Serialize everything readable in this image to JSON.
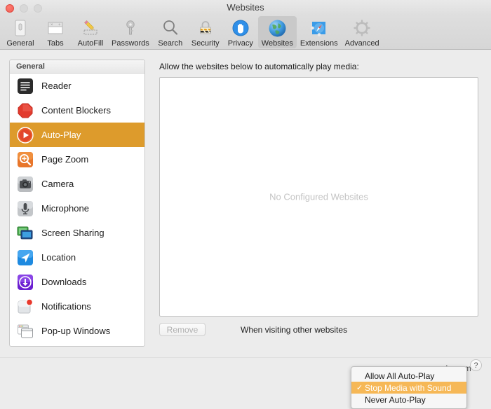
{
  "window": {
    "title": "Websites",
    "traffic_lights": [
      "close",
      "minimize",
      "zoom"
    ]
  },
  "toolbar": {
    "items": [
      {
        "label": "General",
        "icon": "general-icon",
        "selected": false
      },
      {
        "label": "Tabs",
        "icon": "tabs-icon",
        "selected": false
      },
      {
        "label": "AutoFill",
        "icon": "autofill-icon",
        "selected": false
      },
      {
        "label": "Passwords",
        "icon": "passwords-icon",
        "selected": false
      },
      {
        "label": "Search",
        "icon": "search-icon",
        "selected": false
      },
      {
        "label": "Security",
        "icon": "security-icon",
        "selected": false
      },
      {
        "label": "Privacy",
        "icon": "privacy-icon",
        "selected": false
      },
      {
        "label": "Websites",
        "icon": "websites-icon",
        "selected": true
      },
      {
        "label": "Extensions",
        "icon": "extensions-icon",
        "selected": false
      },
      {
        "label": "Advanced",
        "icon": "advanced-icon",
        "selected": false
      }
    ]
  },
  "sidebar": {
    "header": "General",
    "items": [
      {
        "label": "Reader",
        "icon": "reader-icon",
        "selected": false
      },
      {
        "label": "Content Blockers",
        "icon": "content-blockers-icon",
        "selected": false
      },
      {
        "label": "Auto-Play",
        "icon": "auto-play-icon",
        "selected": true
      },
      {
        "label": "Page Zoom",
        "icon": "page-zoom-icon",
        "selected": false
      },
      {
        "label": "Camera",
        "icon": "camera-icon",
        "selected": false
      },
      {
        "label": "Microphone",
        "icon": "microphone-icon",
        "selected": false
      },
      {
        "label": "Screen Sharing",
        "icon": "screen-sharing-icon",
        "selected": false
      },
      {
        "label": "Location",
        "icon": "location-icon",
        "selected": false
      },
      {
        "label": "Downloads",
        "icon": "downloads-icon",
        "selected": false
      },
      {
        "label": "Notifications",
        "icon": "notifications-icon",
        "selected": false
      },
      {
        "label": "Pop-up Windows",
        "icon": "popup-windows-icon",
        "selected": false
      }
    ]
  },
  "main": {
    "title": "Allow the websites below to automatically play media:",
    "empty_message": "No Configured Websites",
    "remove_button": "Remove",
    "footer_label": "When visiting other websites"
  },
  "popup_menu": {
    "items": [
      {
        "label": "Allow All Auto-Play",
        "checked": false
      },
      {
        "label": "Stop Media with Sound",
        "checked": true
      },
      {
        "label": "Never Auto-Play",
        "checked": false
      }
    ],
    "check_glyph": "✓"
  },
  "bottom": {
    "help_label": "?",
    "watermark": "wsxdn.com"
  },
  "colors": {
    "selection_orange": "#dd9b2c",
    "menu_highlight": "#f6b857",
    "window_bg": "#ececec"
  }
}
